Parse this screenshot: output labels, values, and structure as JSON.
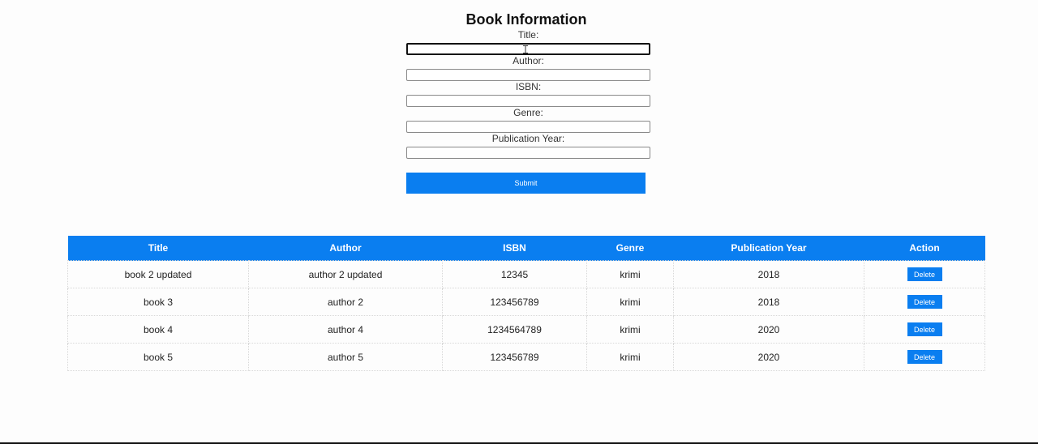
{
  "page": {
    "title": "Book Information"
  },
  "form": {
    "fields": [
      {
        "label": "Title:",
        "value": ""
      },
      {
        "label": "Author:",
        "value": ""
      },
      {
        "label": "ISBN:",
        "value": ""
      },
      {
        "label": "Genre:",
        "value": ""
      },
      {
        "label": "Publication Year:",
        "value": ""
      }
    ],
    "submit_label": "Submit"
  },
  "table": {
    "headers": [
      "Title",
      "Author",
      "ISBN",
      "Genre",
      "Publication Year",
      "Action"
    ],
    "rows": [
      {
        "title": "book 2 updated",
        "author": "author 2 updated",
        "isbn": "12345",
        "genre": "krimi",
        "year": "2018",
        "action": "Delete"
      },
      {
        "title": "book 3",
        "author": "author 2",
        "isbn": "123456789",
        "genre": "krimi",
        "year": "2018",
        "action": "Delete"
      },
      {
        "title": "book 4",
        "author": "author 4",
        "isbn": "1234564789",
        "genre": "krimi",
        "year": "2020",
        "action": "Delete"
      },
      {
        "title": "book 5",
        "author": "author 5",
        "isbn": "123456789",
        "genre": "krimi",
        "year": "2020",
        "action": "Delete"
      }
    ]
  },
  "colors": {
    "accent": "#0a7ef0",
    "header_text": "#ffffff"
  },
  "icons": {
    "cursor": "text-cursor-icon"
  }
}
